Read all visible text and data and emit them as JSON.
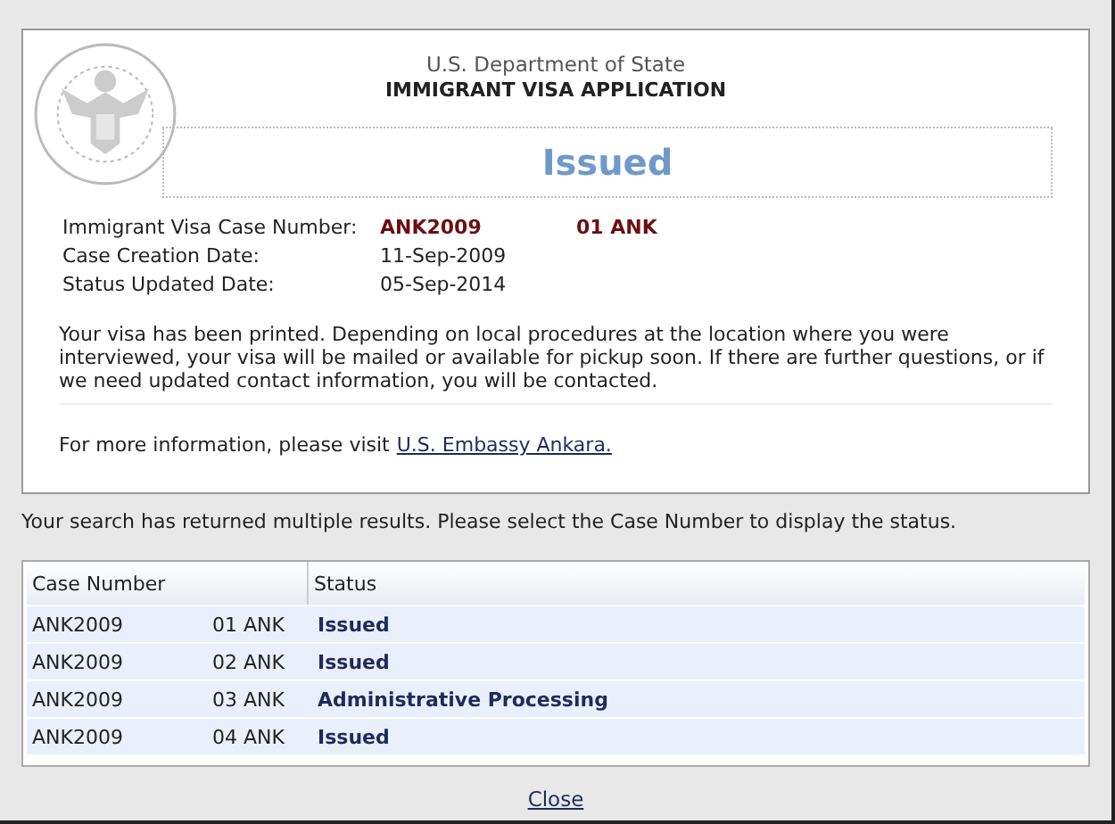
{
  "header": {
    "department": "U.S. Department of State",
    "title": "IMMIGRANT VISA APPLICATION",
    "status": "Issued"
  },
  "details": [
    {
      "label": "Immigrant Visa Case Number:",
      "value": "ANK2009",
      "extra": "01 ANK",
      "highlight": true
    },
    {
      "label": "Case Creation Date:",
      "value": "11-Sep-2009",
      "highlight": false
    },
    {
      "label": "Status Updated Date:",
      "value": "05-Sep-2014",
      "highlight": false
    }
  ],
  "message": "Your visa has been printed. Depending on local procedures at the location where you were interviewed, your visa will be mailed or available for pickup soon. If there are further questions, or if we need updated contact information, you will be contacted.",
  "more_info": {
    "text": "For more information, please visit",
    "link": "U.S. Embassy Ankara."
  },
  "results_note": "Your search has returned multiple results. Please select the Case Number to display the status.",
  "table": {
    "columns": [
      "Case Number",
      "Status"
    ],
    "rows": [
      {
        "case": "ANK2009",
        "suffix": "01 ANK",
        "status": "Issued"
      },
      {
        "case": "ANK2009",
        "suffix": "02 ANK",
        "status": "Issued"
      },
      {
        "case": "ANK2009",
        "suffix": "03 ANK",
        "status": "Administrative Processing"
      },
      {
        "case": "ANK2009",
        "suffix": "04 ANK",
        "status": "Issued"
      }
    ]
  },
  "close": "Close"
}
